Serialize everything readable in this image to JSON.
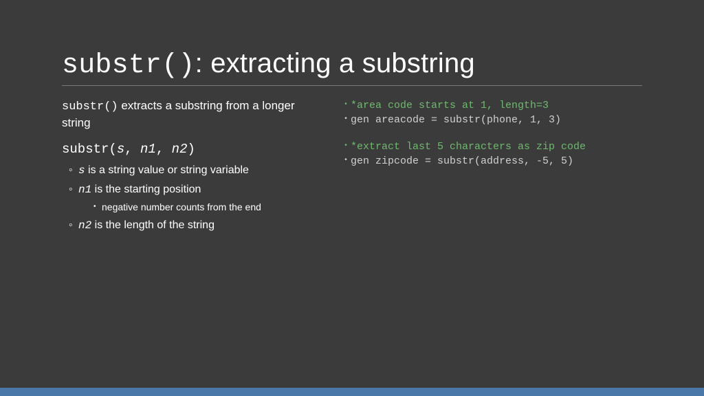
{
  "title": {
    "code": "substr()",
    "sep": ": ",
    "rest": "extracting a substring"
  },
  "left": {
    "intro_code": "substr()",
    "intro_rest": " extracts a substring from a longer string",
    "sig_pre": "substr(",
    "sig_s": "s",
    "sig_c1": ", ",
    "sig_n1": "n1",
    "sig_c2": ", ",
    "sig_n2": "n2",
    "sig_post": ")",
    "b1_s_code": "s",
    "b1_s_rest": " is a string value or string variable",
    "b1_n1_code": "n1",
    "b1_n1_rest": " is the starting position",
    "b2_neg": "negative number counts from the end",
    "b1_n2_code": "n2",
    "b1_n2_rest": " is the length of the string"
  },
  "right": {
    "l1": "*area code starts at 1, length=3",
    "l2": "gen areacode = substr(phone, 1, 3)",
    "l3": "*extract last 5 characters as zip code",
    "l4": "gen zipcode = substr(address, -5, 5)"
  }
}
